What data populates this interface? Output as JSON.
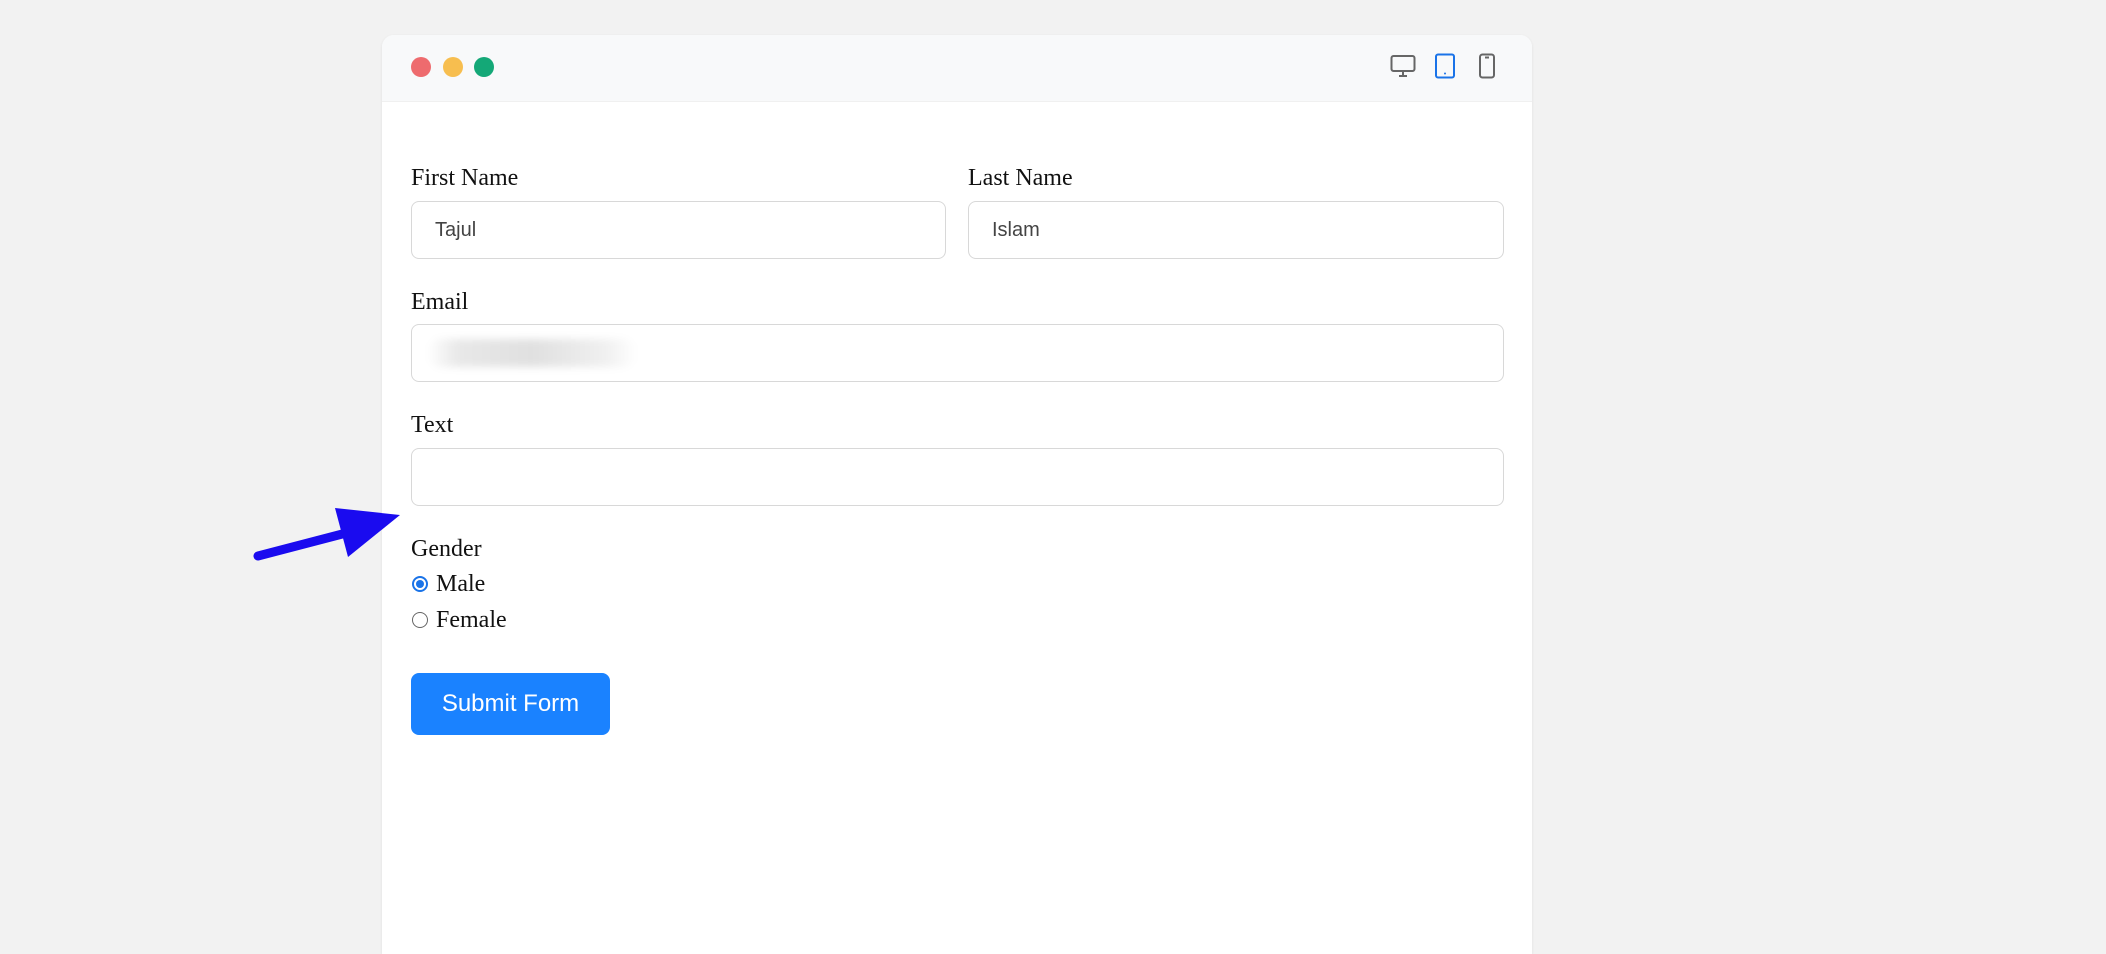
{
  "window": {
    "controls": [
      "close",
      "minimize",
      "maximize"
    ],
    "control_colors": {
      "close": "#ee6b6e",
      "minimize": "#f7be4f",
      "maximize": "#14a877"
    },
    "device_icons": [
      {
        "name": "desktop-icon",
        "active": false
      },
      {
        "name": "tablet-icon",
        "active": true
      },
      {
        "name": "mobile-icon",
        "active": false
      }
    ],
    "active_color": "#1a73e8"
  },
  "form": {
    "first_name": {
      "label": "First Name",
      "value": "Tajul"
    },
    "last_name": {
      "label": "Last Name",
      "value": "Islam"
    },
    "email": {
      "label": "Email",
      "value": ""
    },
    "text": {
      "label": "Text",
      "value": ""
    },
    "gender": {
      "label": "Gender",
      "options": [
        {
          "label": "Male",
          "checked": true
        },
        {
          "label": "Female",
          "checked": false
        }
      ]
    },
    "submit_label": "Submit Form"
  },
  "annotation": {
    "icon": "arrow-icon",
    "color": "#1a0bef"
  }
}
